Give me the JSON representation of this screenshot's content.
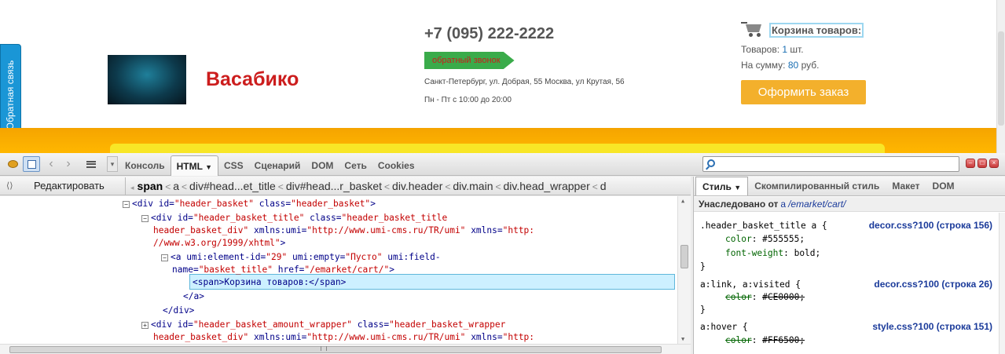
{
  "site": {
    "feedback_tab": "Обратная связь",
    "logo_text": "Васабико",
    "phone": "+7 (095) 222-2222",
    "callback_button": "обратный звонок",
    "address": "Санкт-Петербург, ул. Добрая, 55 Москва, ул Крутая, 56",
    "hours": "Пн - Пт с 10:00 до 20:00",
    "basket": {
      "title": "Корзина товаров:",
      "items_label": "Товаров:",
      "items_count": "1",
      "items_unit": "шт.",
      "sum_label": "На сумму:",
      "sum_value": "80",
      "sum_unit": "руб.",
      "order_button": "Оформить заказ"
    }
  },
  "firebug": {
    "tabs": [
      "Консоль",
      "HTML",
      "CSS",
      "Сценарий",
      "DOM",
      "Сеть",
      "Cookies"
    ],
    "selected_tab": "HTML",
    "search": {
      "value": ""
    },
    "edit_button": "Редактировать",
    "breadcrumbs": [
      "span",
      "a",
      "div#head...et_title",
      "div#head...r_basket",
      "div.header",
      "div.main",
      "div.head_wrapper",
      "d"
    ],
    "html_lines": {
      "l1": {
        "tag_open": "<div",
        "a1": "id=",
        "v1": "\"header_basket\"",
        "a2": "class=",
        "v2": "\"header_basket\"",
        "close": ">"
      },
      "l2": {
        "tag_open": "<div",
        "a1": "id=",
        "v1": "\"header_basket_title\"",
        "a2": "class=",
        "v2": "\"header_basket_title"
      },
      "l3": {
        "v2b": "header_basket_div\"",
        "a3": "xmlns:umi=",
        "v3": "\"http://www.umi-cms.ru/TR/umi\"",
        "a4": "xmlns=",
        "v4": "\"http:"
      },
      "l4": {
        "v4b": "//www.w3.org/1999/xhtml\"",
        "close": ">"
      },
      "l5": {
        "tag_open": "<a",
        "a1": "umi:element-id=",
        "v1": "\"29\"",
        "a2": "umi:empty=",
        "v2": "\"Пусто\"",
        "a3": "umi:field-"
      },
      "l6": {
        "a3b": "name=",
        "v3": "\"basket_title\"",
        "a4": "href=",
        "v4": "\"/emarket/cart/\"",
        "close": ">"
      },
      "l7": {
        "text": "<span>Корзина товаров:</span>"
      },
      "l8": {
        "text": "</a>"
      },
      "l9": {
        "text": "</div>"
      },
      "l10": {
        "tag_open": "<div",
        "a1": "id=",
        "v1": "\"header_basket_amount_wrapper\"",
        "a2": "class=",
        "v2": "\"header_basket_wrapper"
      },
      "l11": {
        "v2b": "header_basket_div\"",
        "a3": "xmlns:umi=",
        "v3": "\"http://www.umi-cms.ru/TR/umi\"",
        "a4": "xmlns=",
        "v4": "\"http:"
      }
    },
    "side_tabs": [
      "Стиль",
      "Скомпилированный стиль",
      "Макет",
      "DOM"
    ],
    "inherited": {
      "label": "Унаследовано от",
      "tag": "a",
      "path": "/emarket/cart/"
    },
    "css_rules": [
      {
        "selector": ".header_basket_title a {",
        "source": "decor.css?100 (строка 156)",
        "props": [
          {
            "name": "color",
            "value": "#555555;",
            "strike": false
          },
          {
            "name": "font-weight",
            "value": "bold;",
            "strike": false
          }
        ]
      },
      {
        "selector": "a:link, a:visited {",
        "source": "decor.css?100 (строка 26)",
        "props": [
          {
            "name": "color",
            "value": "#CE0000;",
            "strike": true
          }
        ]
      },
      {
        "selector": "a:hover {",
        "source": "style.css?100 (строка 151)",
        "props": [
          {
            "name": "color",
            "value": "#FF6500;",
            "strike": true
          }
        ]
      }
    ]
  }
}
